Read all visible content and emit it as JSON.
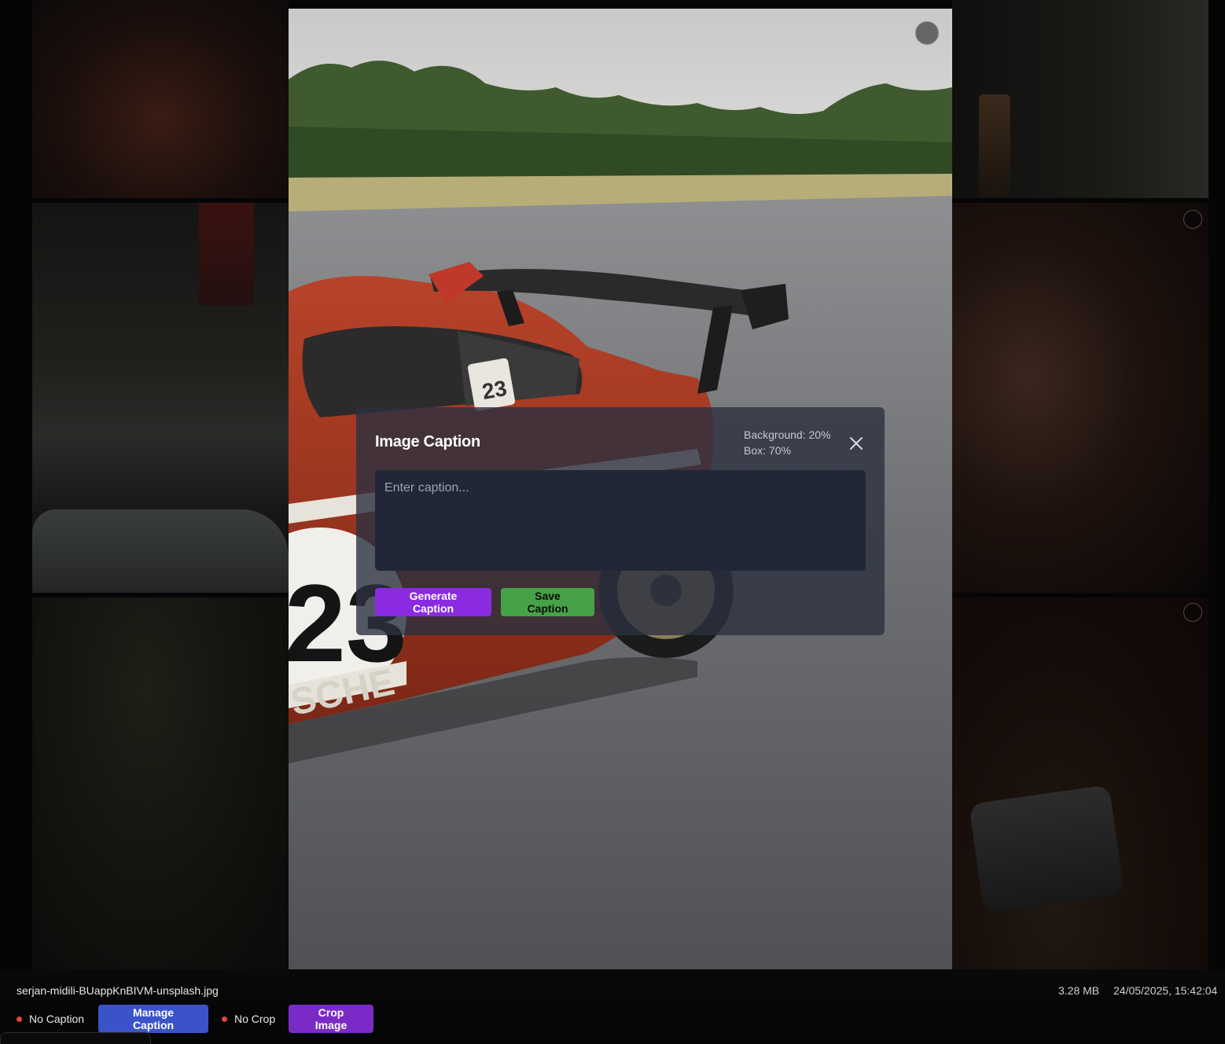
{
  "modal": {
    "title": "Image Caption",
    "background_stat": "Background: 20%",
    "box_stat": "Box: 70%",
    "caption_placeholder": "Enter caption...",
    "caption_value": "",
    "generate_label": "Generate Caption",
    "save_label": "Save Caption",
    "close_icon": "close-icon"
  },
  "file": {
    "name": "serjan-midili-BUappKnBIVM-unsplash.jpg",
    "size": "3.28 MB",
    "date": "24/05/2025, 15:42:04"
  },
  "status": {
    "caption_status": "No Caption",
    "manage_caption_label": "Manage Caption",
    "crop_status": "No Crop",
    "crop_image_label": "Crop Image"
  },
  "colors": {
    "generate_button": "#8a2be2",
    "save_button": "#46a247",
    "manage_button": "#3b53c9",
    "crop_button": "#7a2bc7",
    "status_dot": "#e0443d",
    "modal_bg": "#2c3140"
  }
}
